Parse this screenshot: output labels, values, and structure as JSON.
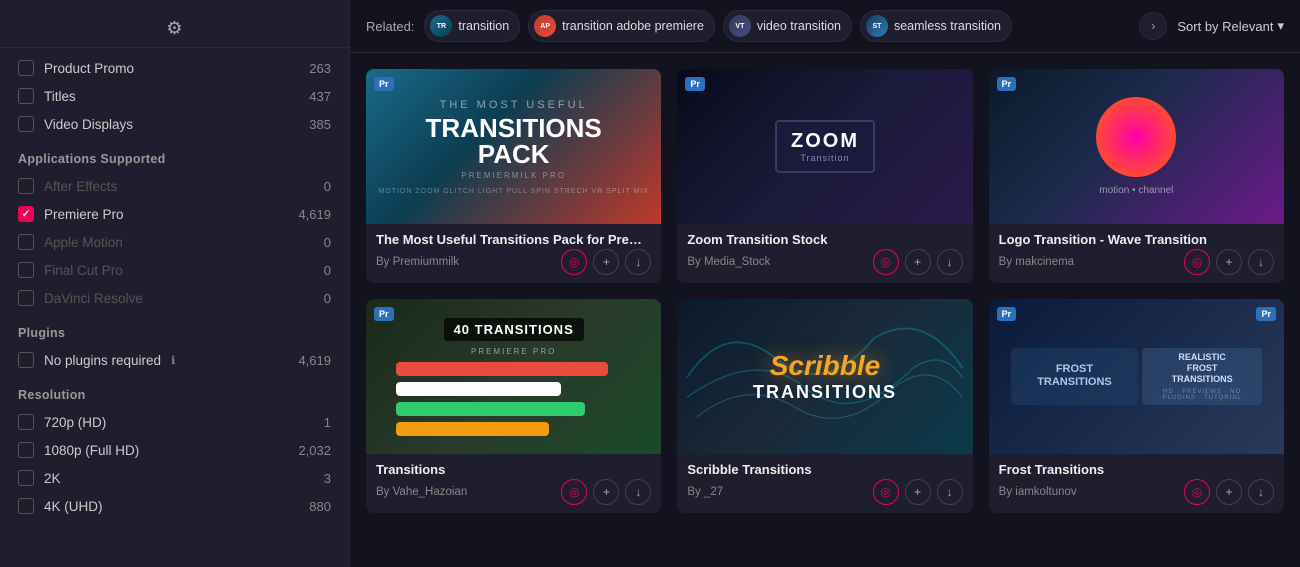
{
  "sidebar": {
    "filter_icon": "⚙",
    "categories": [
      {
        "label": "Product Promo",
        "count": "263",
        "checked": false,
        "disabled": false
      },
      {
        "label": "Titles",
        "count": "437",
        "checked": false,
        "disabled": false
      },
      {
        "label": "Video Displays",
        "count": "385",
        "checked": false,
        "disabled": false
      }
    ],
    "applications_title": "Applications Supported",
    "applications": [
      {
        "label": "After Effects",
        "count": "0",
        "checked": false,
        "disabled": true
      },
      {
        "label": "Premiere Pro",
        "count": "4,619",
        "checked": true,
        "disabled": false
      },
      {
        "label": "Apple Motion",
        "count": "0",
        "checked": false,
        "disabled": true
      },
      {
        "label": "Final Cut Pro",
        "count": "0",
        "checked": false,
        "disabled": true
      },
      {
        "label": "DaVinci Resolve",
        "count": "0",
        "checked": false,
        "disabled": true
      }
    ],
    "plugins_title": "Plugins",
    "plugins": [
      {
        "label": "No plugins required",
        "count": "4,619",
        "checked": false,
        "disabled": false
      }
    ],
    "resolution_title": "Resolution",
    "resolutions": [
      {
        "label": "720p (HD)",
        "count": "1",
        "checked": false
      },
      {
        "label": "1080p (Full HD)",
        "count": "2,032",
        "checked": false
      },
      {
        "label": "2K",
        "count": "3",
        "checked": false
      },
      {
        "label": "4K (UHD)",
        "count": "880",
        "checked": false
      }
    ]
  },
  "related": {
    "label": "Related:",
    "tags": [
      {
        "text": "transition",
        "avatar_class": "tag-avatar-transition",
        "avatar_text": "TR"
      },
      {
        "text": "transition adobe premiere",
        "avatar_class": "tag-avatar-adobe",
        "avatar_text": "AP"
      },
      {
        "text": "video transition",
        "avatar_class": "tag-avatar-video",
        "avatar_text": "VT"
      },
      {
        "text": "seamless transition",
        "avatar_class": "tag-avatar-seamless",
        "avatar_text": "ST"
      }
    ],
    "sort_label": "Sort by Relevant"
  },
  "cards": [
    {
      "id": "transitions-pack",
      "title": "The Most Useful Transitions Pack for Premier...",
      "author": "By Premiummilk",
      "thumb_class": "thumb-transitions-pack",
      "badge": "Pr",
      "badge_class": "pr-badge",
      "thumb_main": "TRANSITIONS",
      "thumb_sub": "PACK"
    },
    {
      "id": "zoom-transition",
      "title": "Zoom Transition Stock",
      "author": "By Media_Stock",
      "thumb_class": "thumb-zoom",
      "badge": "Pr",
      "badge_class": "pr-badge",
      "thumb_main": "ZOOM",
      "thumb_sub": "Transition"
    },
    {
      "id": "logo-wave",
      "title": "Logo Transition - Wave Transition",
      "author": "By makcinema",
      "thumb_class": "thumb-logo-wave",
      "badge": "Pr",
      "badge_class": "pr-badge",
      "thumb_main": "(super)",
      "thumb_sub": ""
    },
    {
      "id": "40-transitions",
      "title": "Transitions",
      "author": "By Vahe_Hazoian",
      "thumb_class": "thumb-40transitions",
      "badge": "Pr",
      "badge_class": "pr-badge",
      "thumb_main": "40 TRANSITIONS",
      "thumb_sub": "PREMIERE PRO"
    },
    {
      "id": "scribble",
      "title": "Scribble Transitions",
      "author": "By _27",
      "thumb_class": "thumb-scribble",
      "badge": "",
      "badge_class": "",
      "thumb_main": "Scribble",
      "thumb_sub": "transitions"
    },
    {
      "id": "frost",
      "title": "Frost Transitions",
      "author": "By iamkoltunov",
      "thumb_class": "thumb-frost",
      "badge": "Pr",
      "badge_class": "pr-badge",
      "thumb_main": "FROST TRANSITIONS",
      "thumb_sub": "REALISTIC FROST TRANSITIONS"
    }
  ],
  "info_icon": "ℹ",
  "actions": {
    "add_to_favorites": "♡",
    "add_to_collection": "+",
    "download": "↓"
  }
}
